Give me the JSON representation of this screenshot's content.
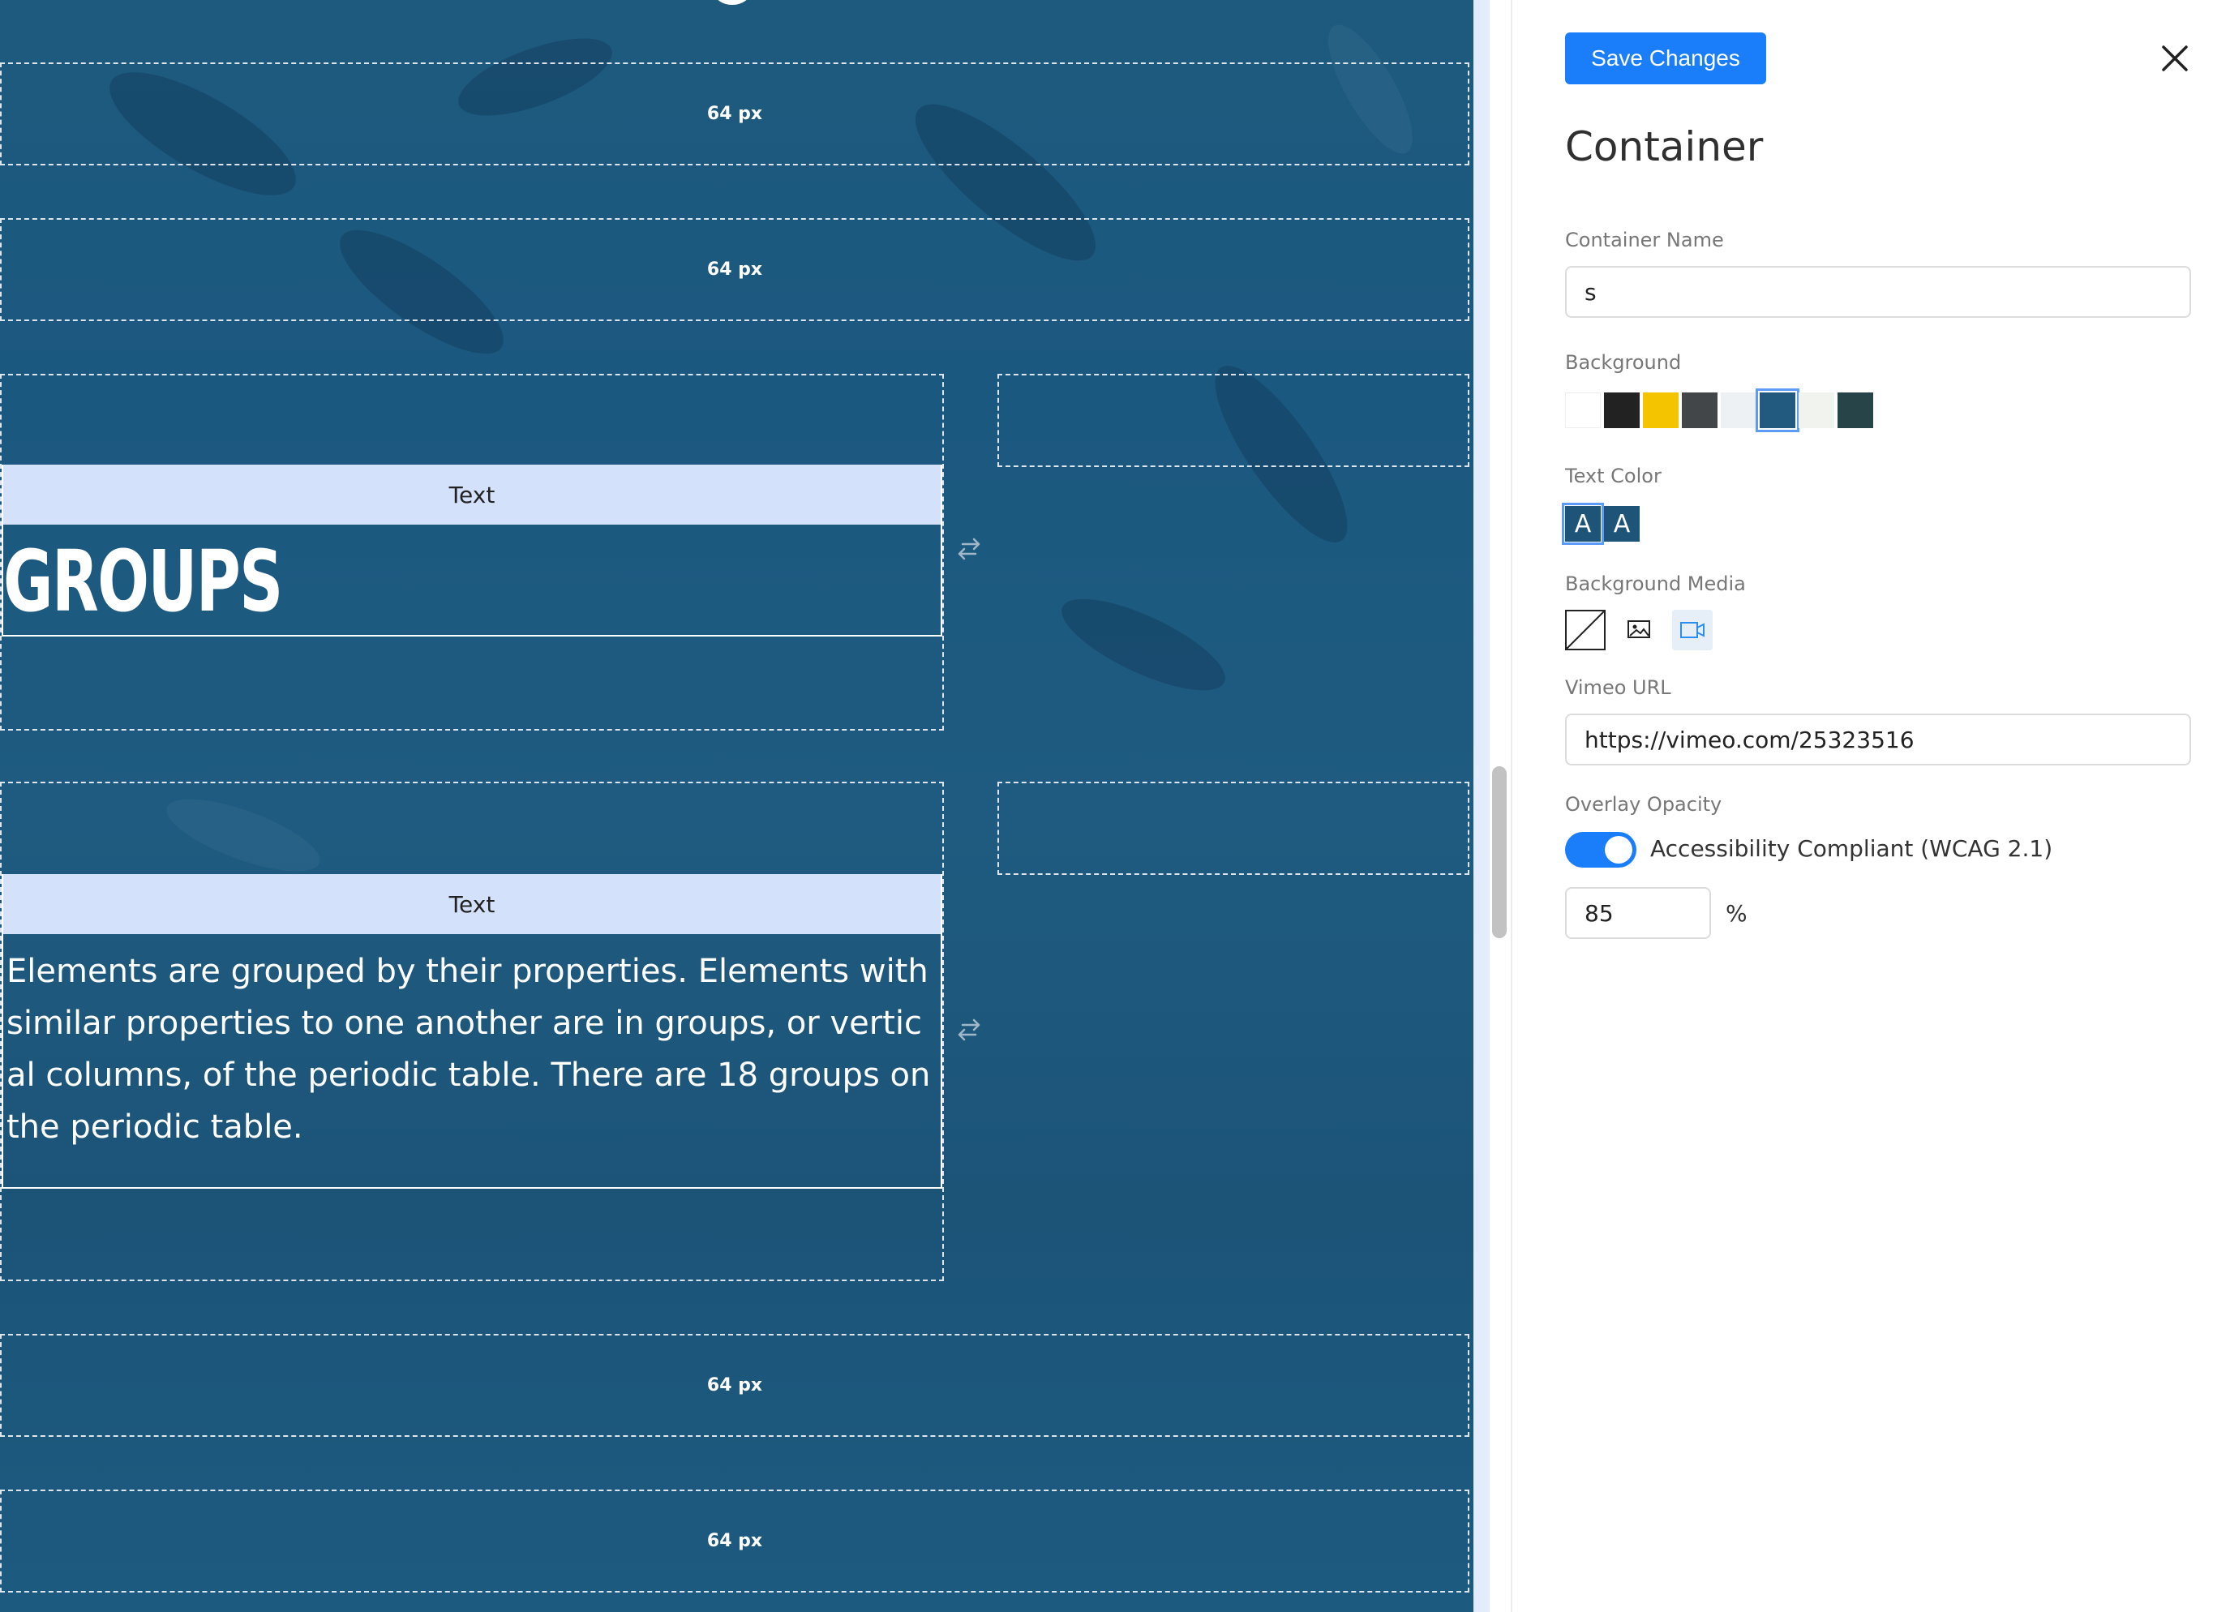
{
  "canvas": {
    "spacers": [
      "64 px",
      "64 px",
      "64 px",
      "64 px"
    ],
    "text_blocks": [
      {
        "label": "Text",
        "heading": "GROUPS"
      },
      {
        "label": "Text",
        "body": "Elements are grouped by their properties. Elements with similar properties to one another are in groups, or vertical columns, of the periodic table. There are 18 groups on the periodic table."
      }
    ]
  },
  "panel": {
    "save_label": "Save Changes",
    "title": "Container",
    "container_name": {
      "label": "Container Name",
      "value": "s"
    },
    "background": {
      "label": "Background",
      "swatches": [
        "#ffffff",
        "#222222",
        "#f5c400",
        "#434649",
        "#eef1f4",
        "#225a7f",
        "#f1f3ee",
        "#274548"
      ],
      "selected_index": 5
    },
    "text_color": {
      "label": "Text Color",
      "options": [
        "A",
        "A"
      ],
      "selected_index": 0
    },
    "background_media": {
      "label": "Background Media",
      "options": [
        "none-icon",
        "image-icon",
        "video-icon"
      ],
      "selected": "video-icon"
    },
    "vimeo": {
      "label": "Vimeo URL",
      "value": "https://vimeo.com/25323516"
    },
    "overlay": {
      "label": "Overlay Opacity",
      "toggle_label": "Accessibility Compliant (WCAG 2.1)",
      "toggle_on": true,
      "value": "85",
      "unit": "%"
    }
  }
}
